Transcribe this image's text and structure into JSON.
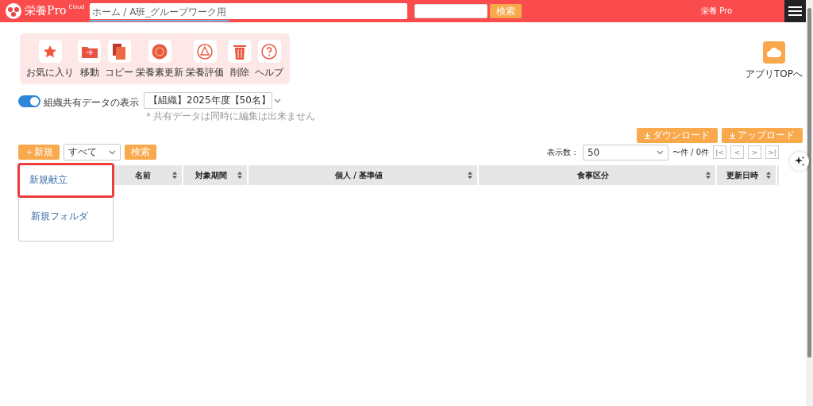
{
  "header": {
    "logo": "栄養Pro",
    "logo_sup": "Cloud",
    "breadcrumb": "ホーム / A班_グループワーク用",
    "search_button": "検索",
    "user": "栄養 Pro"
  },
  "tools": [
    {
      "kind": "star",
      "label": "お気に入り"
    },
    {
      "kind": "move",
      "label": "移動"
    },
    {
      "kind": "copy",
      "label": "コピー"
    },
    {
      "kind": "refresh",
      "label": "栄養素更新"
    },
    {
      "kind": "evaluate",
      "label": "栄養評価"
    },
    {
      "kind": "trash",
      "label": "削除"
    },
    {
      "kind": "help",
      "label": "ヘルプ"
    }
  ],
  "app_top": {
    "label": "アプリTOPへ"
  },
  "shared": {
    "on": true,
    "label": "組織共有データの表示",
    "selection": "【組織】2025年度【50名】",
    "note": "＊共有データは同時に編集は出来ません"
  },
  "actions": {
    "new_button": "＋新規",
    "filter": "すべて",
    "search_button": "検索",
    "download": "ダウンロード",
    "upload": "アップロード"
  },
  "pager": {
    "label": "表示数：",
    "per_page": "50",
    "count": "〜件 / 0件",
    "buttons": [
      "|<",
      "<",
      ">",
      ">|"
    ]
  },
  "table": {
    "columns": [
      {
        "label": "名前"
      },
      {
        "label": "対象期間"
      },
      {
        "label": "個人 / 基準値"
      },
      {
        "label": "食事区分"
      },
      {
        "label": "更新日時"
      }
    ]
  },
  "new_menu": {
    "items": [
      {
        "label": "新規献立",
        "highlighted": true
      },
      {
        "label": "新規フォルダ",
        "highlighted": false
      }
    ]
  }
}
